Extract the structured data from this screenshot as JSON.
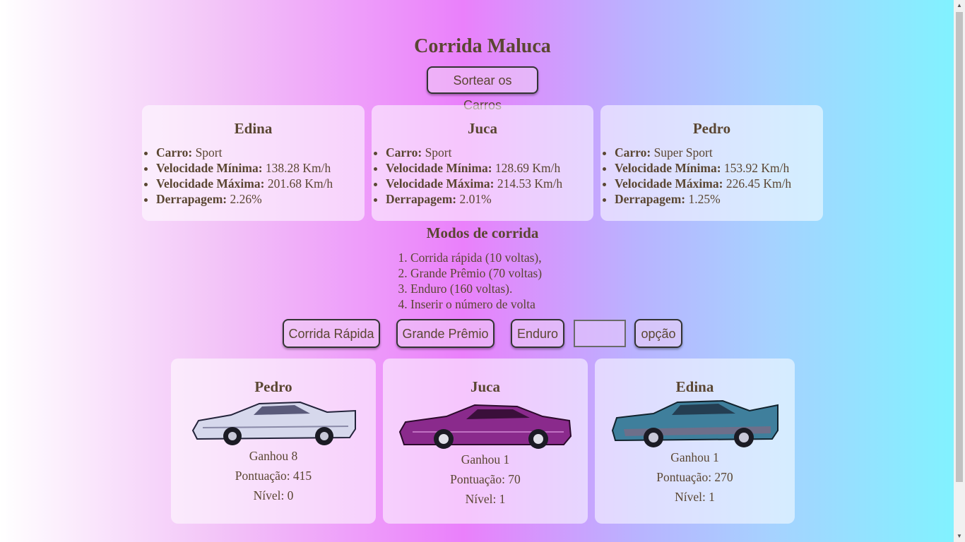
{
  "title": "Corrida Maluca",
  "buttons": {
    "draw": "Sortear os Carros",
    "quick": "Corrida Rápida",
    "grand_prix": "Grande Prêmio",
    "enduro": "Enduro",
    "option": "opção"
  },
  "labels": {
    "car": "Carro:",
    "min_speed": "Velocidade Mínima:",
    "max_speed": "Velocidade Máxima:",
    "drift": "Derrapagem:"
  },
  "drivers": [
    {
      "name": "Edina",
      "car": "Sport",
      "min_speed": "138.28 Km/h",
      "max_speed": "201.68 Km/h",
      "drift": "2.26%"
    },
    {
      "name": "Juca",
      "car": "Sport",
      "min_speed": "128.69 Km/h",
      "max_speed": "214.53 Km/h",
      "drift": "2.01%"
    },
    {
      "name": "Pedro",
      "car": "Super Sport",
      "min_speed": "153.92 Km/h",
      "max_speed": "226.45 Km/h",
      "drift": "1.25%"
    }
  ],
  "modes": {
    "title": "Modos de corrida",
    "items": [
      "Corrida rápida (10 voltas),",
      "Grande Prêmio (70 voltas)",
      "Enduro (160 voltas).",
      "Inserir o número de volta"
    ]
  },
  "laps_input": {
    "value": "",
    "placeholder": ""
  },
  "results": [
    {
      "name": "Pedro",
      "wins": "Ganhou 8",
      "score": "Pontuação: 415",
      "level": "Nível: 0",
      "car_color": "#d6d8ec"
    },
    {
      "name": "Juca",
      "wins": "Ganhou 1",
      "score": "Pontuação: 70",
      "level": "Nível: 1",
      "car_color": "#8a2a8c"
    },
    {
      "name": "Edina",
      "wins": "Ganhou 1",
      "score": "Pontuação: 270",
      "level": "Nível: 1",
      "car_color": "#3f7f9c"
    }
  ]
}
